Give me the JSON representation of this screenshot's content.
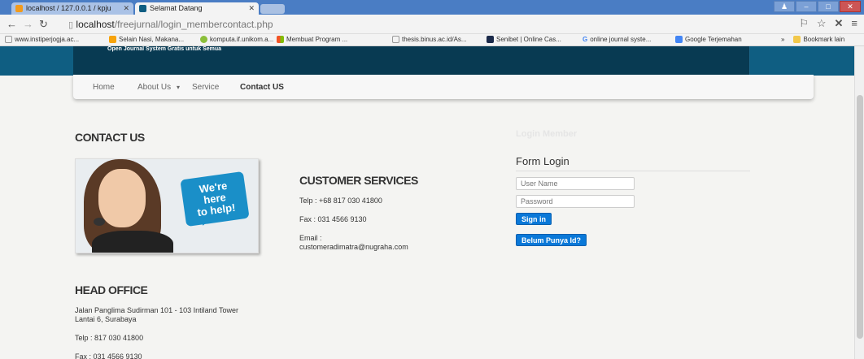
{
  "browser": {
    "tabs": [
      {
        "label": "localhost / 127.0.0.1 / kpju"
      },
      {
        "label": "Selamat Datang"
      }
    ],
    "url_host": "localhost",
    "url_path": "/freejurnal/login_membercontact.php",
    "bookmarks": [
      "www.instiperjogja.ac...",
      "Selain Nasi, Makana...",
      "komputa.if.unikom.a...",
      "Membuat Program ...",
      "thesis.binus.ac.id/As...",
      "Senibet | Online Cas...",
      "online journal syste...",
      "Google Terjemahan"
    ],
    "bookmark_folder": "Bookmark lain"
  },
  "site": {
    "tagline": "Open Journal System Gratis untuk Semua",
    "menu": [
      "Home",
      "About Us",
      "Service",
      "Contact US"
    ],
    "contact_heading": "CONTACT US",
    "help_bubble": [
      "We're",
      "here",
      "to help!"
    ],
    "customer_services": {
      "heading": "CUSTOMER SERVICES",
      "telp": "Telp : +68 817 030 41800",
      "fax": "Fax : 031 4566 9130",
      "email_label": "Email :",
      "email": "customeradimatra@nugraha.com"
    },
    "head_office": {
      "heading": "HEAD OFFICE",
      "address_line1": "Jalan Panglima Sudirman 101 - 103 Intiland Tower",
      "address_line2": "Lantai 6, Surabaya",
      "telp": "Telp : 817 030 41800",
      "fax": "Fax : 031 4566 9130"
    },
    "login": {
      "faint_title": "Login Member",
      "title": "Form Login",
      "username_placeholder": "User Name",
      "password_placeholder": "Password",
      "signin": "Sign in",
      "register": "Belum Punya Id?"
    }
  }
}
